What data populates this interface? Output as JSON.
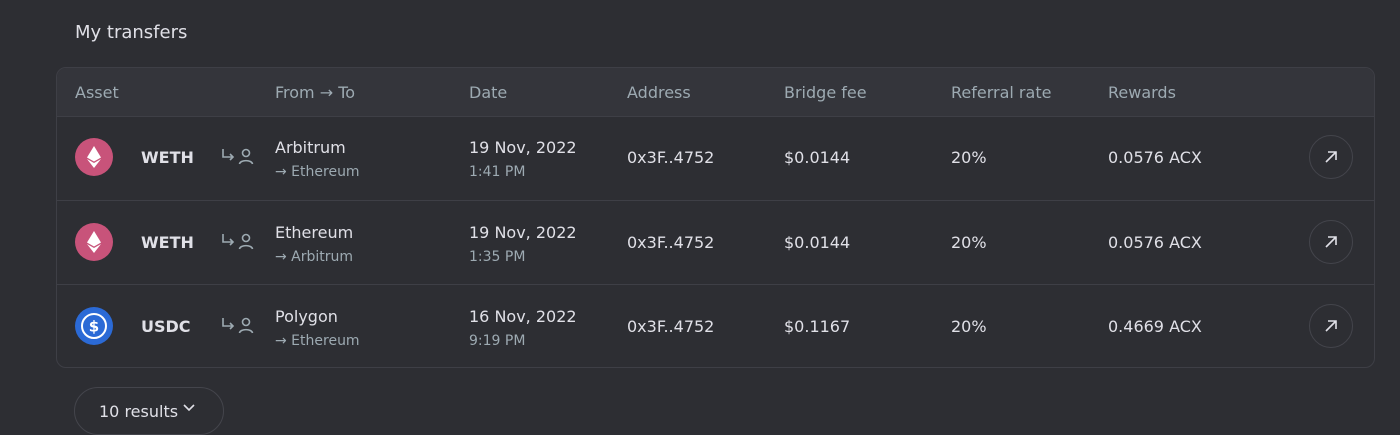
{
  "header": {
    "title": "My transfers"
  },
  "table": {
    "columns": [
      "Asset",
      "From → To",
      "Date",
      "Address",
      "Bridge fee",
      "Referral rate",
      "Rewards"
    ],
    "rows": [
      {
        "asset": "WETH",
        "icon": "ethereum-icon",
        "icon_color": "#c8537a",
        "from": "Arbitrum",
        "to": "→ Ethereum",
        "date": "19 Nov, 2022",
        "time": "1:41 PM",
        "address": "0x3F..4752",
        "bridge_fee": "$0.0144",
        "referral_rate": "20%",
        "rewards": "0.0576 ACX"
      },
      {
        "asset": "WETH",
        "icon": "ethereum-icon",
        "icon_color": "#c8537a",
        "from": "Ethereum",
        "to": "→ Arbitrum",
        "date": "19 Nov, 2022",
        "time": "1:35 PM",
        "address": "0x3F..4752",
        "bridge_fee": "$0.0144",
        "referral_rate": "20%",
        "rewards": "0.0576 ACX"
      },
      {
        "asset": "USDC",
        "icon": "usdc-icon",
        "icon_color": "#2b6ad6",
        "from": "Polygon",
        "to": "→ Ethereum",
        "date": "16 Nov, 2022",
        "time": "9:19 PM",
        "address": "0x3F..4752",
        "bridge_fee": "$0.1167",
        "referral_rate": "20%",
        "rewards": "0.4669 ACX"
      }
    ]
  },
  "pagination": {
    "results_label": "10 results"
  },
  "colors": {
    "background": "#2d2e33",
    "header_bg": "#34353b",
    "border": "#3e3f46",
    "text_primary": "#e0e0e7",
    "text_secondary": "#9daab2"
  }
}
